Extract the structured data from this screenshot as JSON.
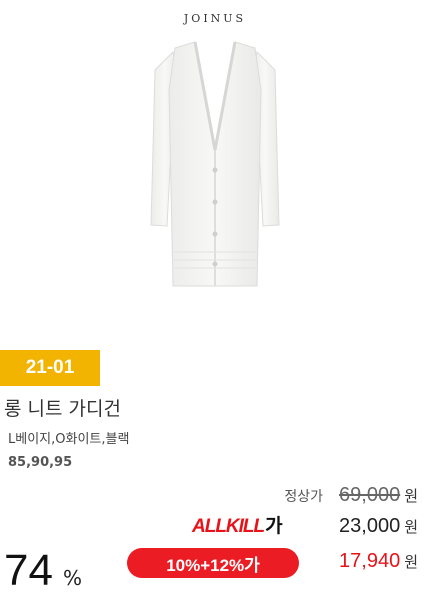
{
  "brand": "JOINUS",
  "product": {
    "code": "21-01",
    "name": "롱 니트 가디건",
    "colors": "L베이지,O화이트,블랙",
    "sizes": "85,90,95",
    "image_icon": "white-long-knit-cardigan"
  },
  "pricing": {
    "list_label": "정상가",
    "list_price": "69,000",
    "currency": "원",
    "allkill_logo": "ALLKILL",
    "allkill_suffix": "가",
    "allkill_price": "23,000",
    "coupon_label": "10%+12%가",
    "final_price": "17,940",
    "discount_value": "74",
    "discount_unit": "%"
  },
  "colors": {
    "badge": "#f2b400",
    "accent_red": "#ec1c24"
  }
}
